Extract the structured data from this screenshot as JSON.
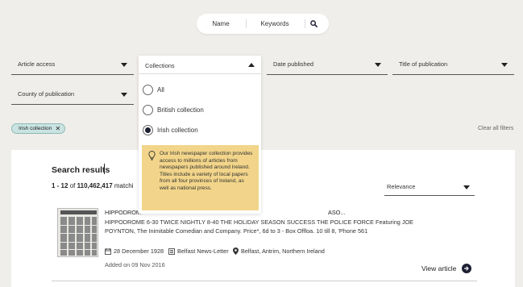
{
  "search": {
    "name_label": "Name",
    "keywords_label": "Keywords",
    "icon": "search-icon"
  },
  "filters": {
    "article_access": "Article access",
    "collections": "Collections",
    "date_published": "Date published",
    "title_of_publication": "Title of publication",
    "county_of_publication": "County of publication"
  },
  "collections_dropdown": {
    "options": [
      {
        "label": "All",
        "selected": false
      },
      {
        "label": "British collection",
        "selected": false
      },
      {
        "label": "Irish collection",
        "selected": true
      }
    ],
    "info_text": "Our Irish newspaper collection provides access to millions of articles from newspapers published around Ireland. Titles include a variety of local papers from all four provinces of Ireland, as well as national press.",
    "info_icon": "lightbulb-icon",
    "info_color": "#f2d58a"
  },
  "active_filters": {
    "chip_label": "Irish collection",
    "clear_all": "Clear all filters"
  },
  "results": {
    "title": "Search results",
    "range": "1 - 12",
    "of": "of",
    "total": "110,462,417",
    "matching_suffix": "matchi",
    "sort_value": "Relevance",
    "items": [
      {
        "title": "HIPPODROM",
        "title_tail": "ASO...",
        "snippet": "HIPPODROME 6-30 TWICE NIGHTLY 8-40 THE HOLIDAY SEASON SUCCESS THE POLICE FORCE Featuring JOE POYNTON, The Inimitable Comedian and Company. Price*, 6d to 3 - Box Offloa. 10 till 8, 'Phone 561",
        "date": "28 December 1928",
        "newspaper": "Belfast News-Letter",
        "location": "Belfast, Antrim, Northern Ireland",
        "added": "Added on 09 Nov 2016",
        "view_label": "View article"
      }
    ]
  },
  "colors": {
    "background": "#f0eeea",
    "chip": "#c9e4e2",
    "navy": "#1d1f33"
  }
}
